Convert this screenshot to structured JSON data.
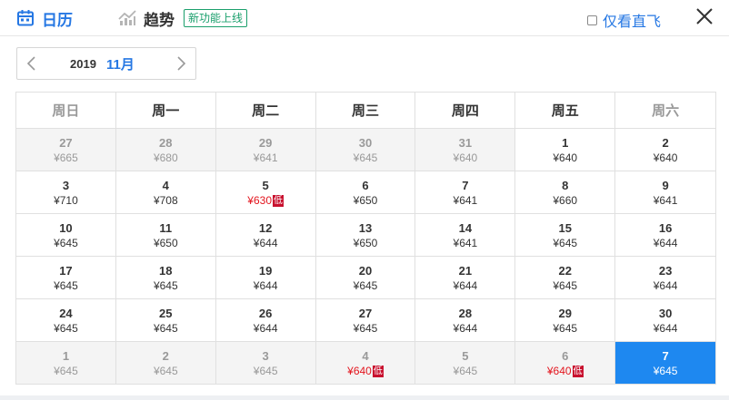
{
  "tabs": [
    {
      "label": "日历",
      "icon": "calendar-icon",
      "active": true
    },
    {
      "label": "趋势",
      "icon": "trend-chart-icon",
      "active": false
    }
  ],
  "new_badge": "新功能上线",
  "direct_filter": {
    "label": "仅看直飞",
    "checked": false
  },
  "month_nav": {
    "year": "2019",
    "month": "11月"
  },
  "weekdays": [
    "周日",
    "周一",
    "周二",
    "周三",
    "周四",
    "周五",
    "周六"
  ],
  "low_label": "低",
  "colors": {
    "accent": "#2577e3",
    "selected": "#1e88f0",
    "low": "#e3151e",
    "badge": "#1a9f6c"
  },
  "weeks": [
    [
      {
        "day": "27",
        "price": "¥665",
        "other": true
      },
      {
        "day": "28",
        "price": "¥680",
        "other": true
      },
      {
        "day": "29",
        "price": "¥641",
        "other": true
      },
      {
        "day": "30",
        "price": "¥645",
        "other": true
      },
      {
        "day": "31",
        "price": "¥640",
        "other": true
      },
      {
        "day": "1",
        "price": "¥640"
      },
      {
        "day": "2",
        "price": "¥640"
      }
    ],
    [
      {
        "day": "3",
        "price": "¥710"
      },
      {
        "day": "4",
        "price": "¥708"
      },
      {
        "day": "5",
        "price": "¥630",
        "low": true
      },
      {
        "day": "6",
        "price": "¥650"
      },
      {
        "day": "7",
        "price": "¥641"
      },
      {
        "day": "8",
        "price": "¥660"
      },
      {
        "day": "9",
        "price": "¥641"
      }
    ],
    [
      {
        "day": "10",
        "price": "¥645"
      },
      {
        "day": "11",
        "price": "¥650"
      },
      {
        "day": "12",
        "price": "¥644"
      },
      {
        "day": "13",
        "price": "¥650"
      },
      {
        "day": "14",
        "price": "¥641"
      },
      {
        "day": "15",
        "price": "¥645"
      },
      {
        "day": "16",
        "price": "¥644"
      }
    ],
    [
      {
        "day": "17",
        "price": "¥645"
      },
      {
        "day": "18",
        "price": "¥645"
      },
      {
        "day": "19",
        "price": "¥644"
      },
      {
        "day": "20",
        "price": "¥645"
      },
      {
        "day": "21",
        "price": "¥644"
      },
      {
        "day": "22",
        "price": "¥645"
      },
      {
        "day": "23",
        "price": "¥644"
      }
    ],
    [
      {
        "day": "24",
        "price": "¥645"
      },
      {
        "day": "25",
        "price": "¥645"
      },
      {
        "day": "26",
        "price": "¥644"
      },
      {
        "day": "27",
        "price": "¥645"
      },
      {
        "day": "28",
        "price": "¥644"
      },
      {
        "day": "29",
        "price": "¥645"
      },
      {
        "day": "30",
        "price": "¥644"
      }
    ],
    [
      {
        "day": "1",
        "price": "¥645",
        "other": true
      },
      {
        "day": "2",
        "price": "¥645",
        "other": true
      },
      {
        "day": "3",
        "price": "¥645",
        "other": true
      },
      {
        "day": "4",
        "price": "¥640",
        "other": true,
        "low": true
      },
      {
        "day": "5",
        "price": "¥645",
        "other": true
      },
      {
        "day": "6",
        "price": "¥640",
        "other": true,
        "low": true
      },
      {
        "day": "7",
        "price": "¥645",
        "selected": true
      }
    ]
  ]
}
